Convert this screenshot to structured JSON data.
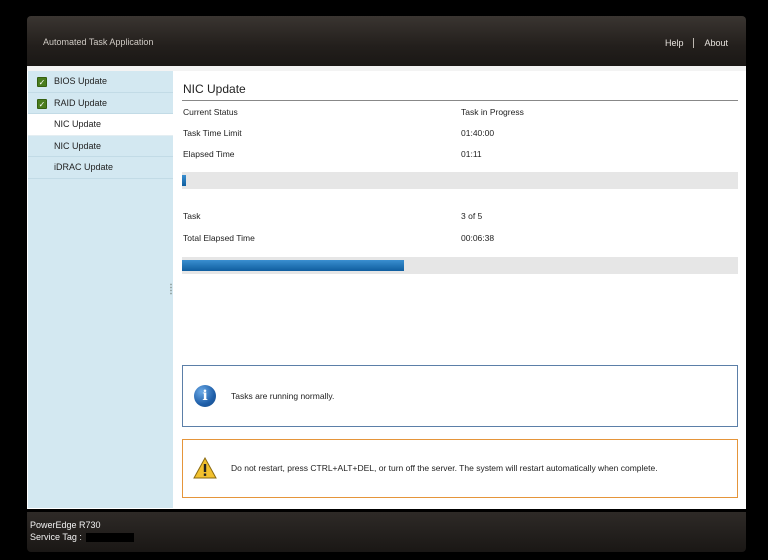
{
  "header": {
    "app_title": "Automated Task Application",
    "links": [
      "Help",
      "About"
    ]
  },
  "sidebar": {
    "items": [
      {
        "label": "BIOS Update",
        "status": "complete",
        "icon": "check-icon"
      },
      {
        "label": "RAID Update",
        "status": "complete",
        "icon": "check-icon"
      },
      {
        "label": "NIC Update",
        "status": "active"
      },
      {
        "label": "NIC Update",
        "status": "pending"
      },
      {
        "label": "iDRAC Update",
        "status": "pending"
      }
    ]
  },
  "main": {
    "title": "NIC Update",
    "current_task": {
      "status_label": "Current Status",
      "status_value": "Task in Progress",
      "time_limit_label": "Task Time Limit",
      "time_limit_value": "01:40:00",
      "elapsed_label": "Elapsed Time",
      "elapsed_value": "01:11",
      "progress_fraction": 0.007
    },
    "overall": {
      "task_label": "Task",
      "task_value": "3 of 5",
      "total_elapsed_label": "Total Elapsed Time",
      "total_elapsed_value": "00:06:38",
      "progress_fraction": 0.4
    },
    "info_message": {
      "icon": "info-icon",
      "text": "Tasks are running normally."
    },
    "warning_message": {
      "icon": "warning-icon",
      "text": "Do not restart, press CTRL+ALT+DEL, or turn off the server.  The system will restart automatically when complete."
    }
  },
  "footer": {
    "model": "PowerEdge R730",
    "service_tag_label": "Service Tag :"
  },
  "colors": {
    "progress": "#1565a8",
    "sidebar_bg": "#d3e8f1",
    "check": "#4a7d1e",
    "warning_border": "#e5953a",
    "info_border": "#5b7fa8"
  }
}
